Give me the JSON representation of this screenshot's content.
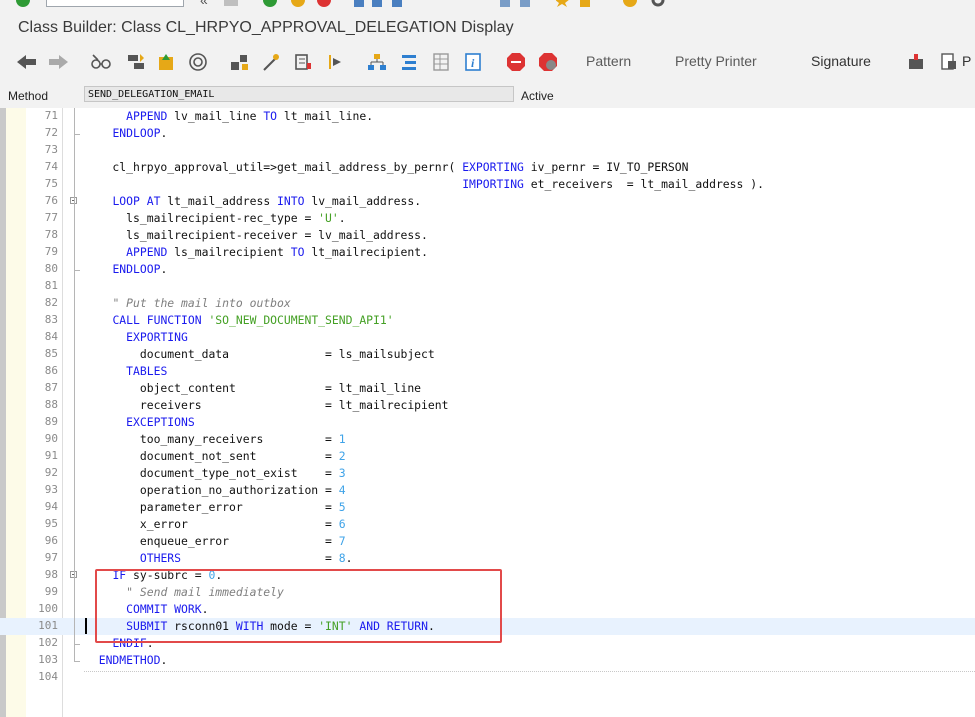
{
  "window": {
    "title": "Class Builder: Class CL_HRPYO_APPROVAL_DELEGATION Display"
  },
  "toolbar": {
    "buttons": [
      "back-icon",
      "forward-icon",
      "glasses-icon",
      "toggle-icon",
      "activate-icon",
      "where-used-icon",
      "hierarchy-icon",
      "wand-icon",
      "display-object-list-icon",
      "breakpoint-arrow-icon",
      "tree-icon",
      "indent-icon",
      "table-icon",
      "info-icon",
      "stop-icon",
      "watchpoint-icon"
    ],
    "pattern": "Pattern",
    "pretty_printer": "Pretty Printer",
    "signature": "Signature"
  },
  "method_row": {
    "label": "Method",
    "value": "SEND_DELEGATION_EMAIL",
    "status": "Active"
  },
  "editor": {
    "current_line": "101",
    "lines": [
      {
        "no": "71",
        "fold": false,
        "html": "      <span class=\"k\">APPEND</span> lv_mail_line <span class=\"k\">TO</span> lt_mail_line."
      },
      {
        "no": "72",
        "fold": false,
        "html": "    <span class=\"k\">ENDLOOP</span>."
      },
      {
        "no": "73",
        "fold": false,
        "html": ""
      },
      {
        "no": "74",
        "fold": false,
        "html": "    cl_hrpyo_approval_util=>get_mail_address_by_pernr( <span class=\"k\">EXPORTING</span> iv_pernr = IV_TO_PERSON"
      },
      {
        "no": "75",
        "fold": false,
        "html": "                                                       <span class=\"k\">IMPORTING</span> et_receivers  = lt_mail_address )."
      },
      {
        "no": "76",
        "fold": true,
        "html": "    <span class=\"k\">LOOP AT</span> lt_mail_address <span class=\"k\">INTO</span> lv_mail_address."
      },
      {
        "no": "77",
        "fold": false,
        "html": "      ls_mailrecipient-rec_type = <span class=\"s\">'U'</span>."
      },
      {
        "no": "78",
        "fold": false,
        "html": "      ls_mailrecipient-receiver = lv_mail_address."
      },
      {
        "no": "79",
        "fold": false,
        "html": "      <span class=\"k\">APPEND</span> ls_mailrecipient <span class=\"k\">TO</span> lt_mailrecipient."
      },
      {
        "no": "80",
        "fold": false,
        "html": "    <span class=\"k\">ENDLOOP</span>."
      },
      {
        "no": "81",
        "fold": false,
        "html": ""
      },
      {
        "no": "82",
        "fold": false,
        "html": "    <span class=\"c\">\" Put the mail into outbox</span>"
      },
      {
        "no": "83",
        "fold": false,
        "html": "    <span class=\"k\">CALL FUNCTION</span> <span class=\"s\">'SO_NEW_DOCUMENT_SEND_API1'</span>"
      },
      {
        "no": "84",
        "fold": false,
        "html": "      <span class=\"k\">EXPORTING</span>"
      },
      {
        "no": "85",
        "fold": false,
        "html": "        document_data              = ls_mailsubject"
      },
      {
        "no": "86",
        "fold": false,
        "html": "      <span class=\"k\">TABLES</span>"
      },
      {
        "no": "87",
        "fold": false,
        "html": "        object_content             = lt_mail_line"
      },
      {
        "no": "88",
        "fold": false,
        "html": "        receivers                  = lt_mailrecipient"
      },
      {
        "no": "89",
        "fold": false,
        "html": "      <span class=\"k\">EXCEPTIONS</span>"
      },
      {
        "no": "90",
        "fold": false,
        "html": "        too_many_receivers         = <span class=\"n\">1</span>"
      },
      {
        "no": "91",
        "fold": false,
        "html": "        document_not_sent          = <span class=\"n\">2</span>"
      },
      {
        "no": "92",
        "fold": false,
        "html": "        document_type_not_exist    = <span class=\"n\">3</span>"
      },
      {
        "no": "93",
        "fold": false,
        "html": "        operation_no_authorization = <span class=\"n\">4</span>"
      },
      {
        "no": "94",
        "fold": false,
        "html": "        parameter_error            = <span class=\"n\">5</span>"
      },
      {
        "no": "95",
        "fold": false,
        "html": "        x_error                    = <span class=\"n\">6</span>"
      },
      {
        "no": "96",
        "fold": false,
        "html": "        enqueue_error              = <span class=\"n\">7</span>"
      },
      {
        "no": "97",
        "fold": false,
        "html": "        <span class=\"k\">OTHERS</span>                     = <span class=\"n\">8</span>."
      },
      {
        "no": "98",
        "fold": true,
        "html": "    <span class=\"k\">IF</span> sy-subrc = <span class=\"n\">0</span>."
      },
      {
        "no": "99",
        "fold": false,
        "html": "      <span class=\"c\">\" Send mail immediately</span>"
      },
      {
        "no": "100",
        "fold": false,
        "html": "      <span class=\"k\">COMMIT WORK</span>."
      },
      {
        "no": "101",
        "fold": false,
        "html": "      <span class=\"k\">SUBMIT</span> rsconn01 <span class=\"k\">WITH</span> mode = <span class=\"s\">'INT'</span> <span class=\"k\">AND RETURN</span>."
      },
      {
        "no": "102",
        "fold": false,
        "html": "    <span class=\"k\">ENDIF</span>."
      },
      {
        "no": "103",
        "fold": false,
        "html": "  <span class=\"k\">ENDMETHOD</span>."
      },
      {
        "no": "104",
        "fold": false,
        "html": ""
      }
    ]
  }
}
